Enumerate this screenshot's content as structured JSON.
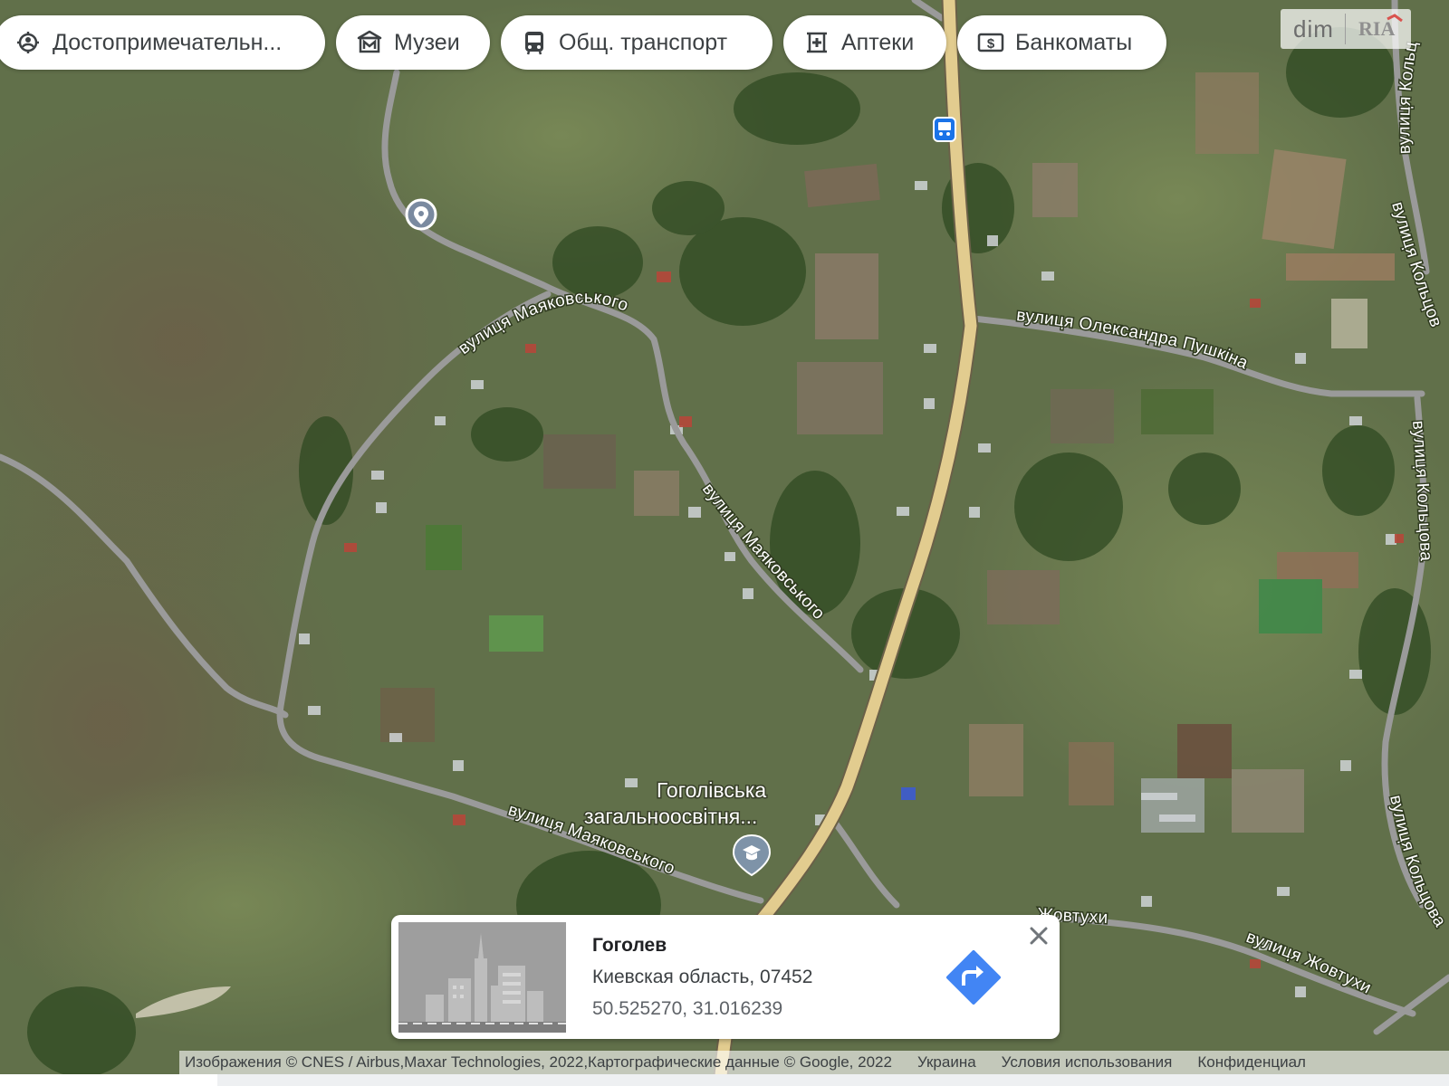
{
  "chips": [
    {
      "label": "Достопримечательн...",
      "icon": "landmark-icon"
    },
    {
      "label": "Музеи",
      "icon": "museum-icon"
    },
    {
      "label": "Общ. транспорт",
      "icon": "transit-icon"
    },
    {
      "label": "Аптеки",
      "icon": "pharmacy-icon"
    },
    {
      "label": "Банкоматы",
      "icon": "atm-icon"
    }
  ],
  "logo": {
    "text": "dim",
    "mark": "RIA"
  },
  "streets": {
    "mayakovskoho": "вулиця Маяковського",
    "pushkina": "вулиця Олександра Пушкіна",
    "koltsova": "вулиця Кольцова",
    "zhovtukhy": "вулиця Жовтухи",
    "zhovtukhy_partial": "Жовтухи"
  },
  "poi": {
    "school_line1": "Гоголівська",
    "school_line2": "загальноосвітня..."
  },
  "card": {
    "title": "Гоголев",
    "region": "Киевская область, 07452",
    "coords": "50.525270, 31.016239"
  },
  "attribution": {
    "text": "Изображения © CNES / Airbus,Maxar Technologies, 2022,Картографические данные © Google, 2022",
    "country": "Украина",
    "terms": "Условия использования",
    "privacy": "Конфиденциал"
  },
  "colors": {
    "main_road": "#e2cc8f",
    "side_road": "#9a9a9a",
    "accent": "#4285f4"
  }
}
